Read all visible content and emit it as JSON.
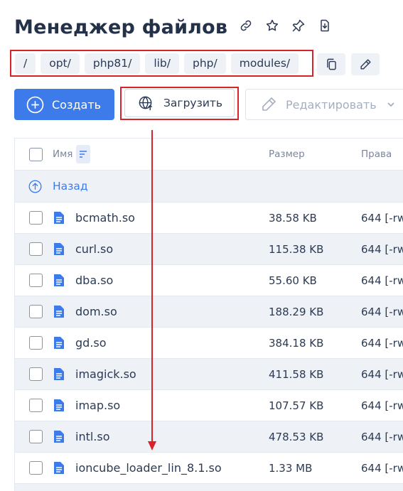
{
  "header": {
    "title": "Менеджер файлов",
    "icons": [
      "link-icon",
      "star-icon",
      "pin-icon",
      "download-icon"
    ]
  },
  "breadcrumb": {
    "items": [
      "/",
      "opt/",
      "php81/",
      "lib/",
      "php/",
      "modules/"
    ],
    "actions": [
      "copy-icon",
      "pencil-icon"
    ]
  },
  "toolbar": {
    "create_label": "Создать",
    "upload_label": "Загрузить",
    "edit_label": "Редактировать"
  },
  "table": {
    "columns": {
      "name": "Имя",
      "size": "Размер",
      "perms": "Права"
    },
    "back_label": "Назад",
    "rows": [
      {
        "name": "bcmath.so",
        "size": "38.58 KB",
        "perms": "644 [-rw"
      },
      {
        "name": "curl.so",
        "size": "115.38 KB",
        "perms": "644 [-rw"
      },
      {
        "name": "dba.so",
        "size": "55.60 KB",
        "perms": "644 [-rw"
      },
      {
        "name": "dom.so",
        "size": "188.29 KB",
        "perms": "644 [-rw"
      },
      {
        "name": "gd.so",
        "size": "384.18 KB",
        "perms": "644 [-rw"
      },
      {
        "name": "imagick.so",
        "size": "411.58 KB",
        "perms": "644 [-rw"
      },
      {
        "name": "imap.so",
        "size": "107.57 KB",
        "perms": "644 [-rw"
      },
      {
        "name": "intl.so",
        "size": "478.53 KB",
        "perms": "644 [-rw"
      },
      {
        "name": "ioncube_loader_lin_8.1.so",
        "size": "1.33 MB",
        "perms": "644 [-rw"
      }
    ]
  },
  "colors": {
    "accent": "#3d7bea",
    "annotation": "#d8232a",
    "row_alt": "#eef1f6"
  }
}
